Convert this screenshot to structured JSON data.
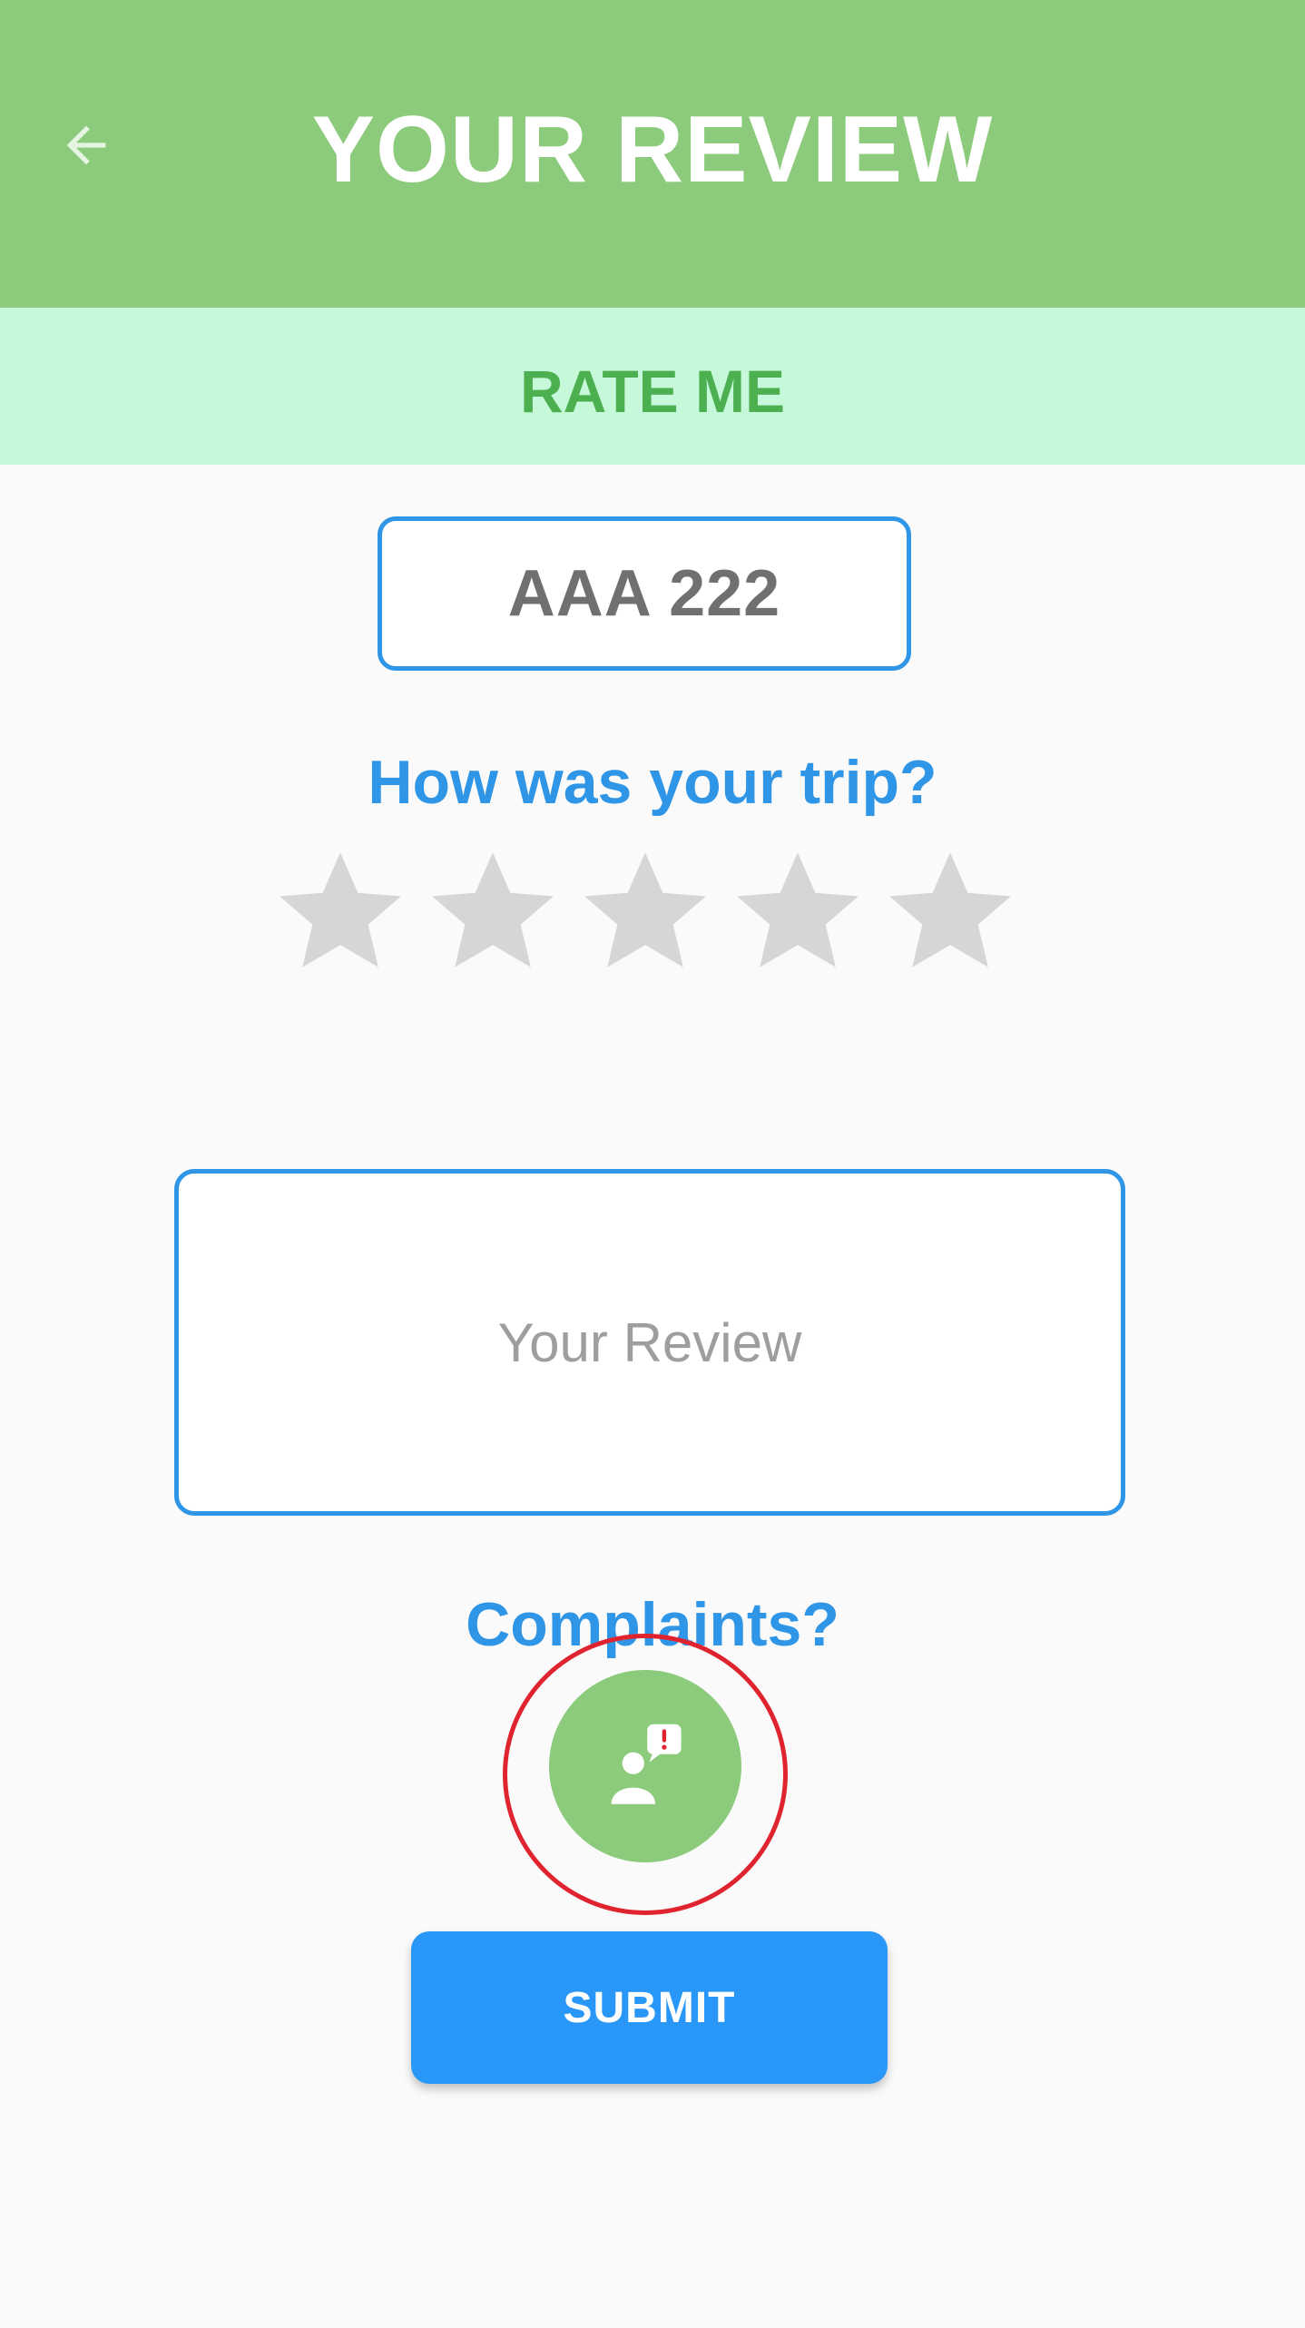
{
  "header": {
    "title": "YOUR REVIEW",
    "back_icon": "arrow-left-icon",
    "background_color": "#8cca7c"
  },
  "rate_band": {
    "label": "RATE ME",
    "background_color": "#c5f9d9"
  },
  "plate": {
    "value": "AAA 222"
  },
  "rating": {
    "question": "How was your trip?",
    "max_stars": 5,
    "selected": 0,
    "star_icon": "star-icon",
    "empty_color": "#d6d6d6"
  },
  "review": {
    "placeholder": "Your Review",
    "value": ""
  },
  "complaints": {
    "label": "Complaints?",
    "icon": "user-complaint-icon",
    "highlight_color": "#e0242f"
  },
  "submit": {
    "label": "SUBMIT",
    "color": "#2897f7"
  },
  "theme": {
    "accent_blue": "#2f95e6",
    "accent_green": "#4caf50"
  }
}
